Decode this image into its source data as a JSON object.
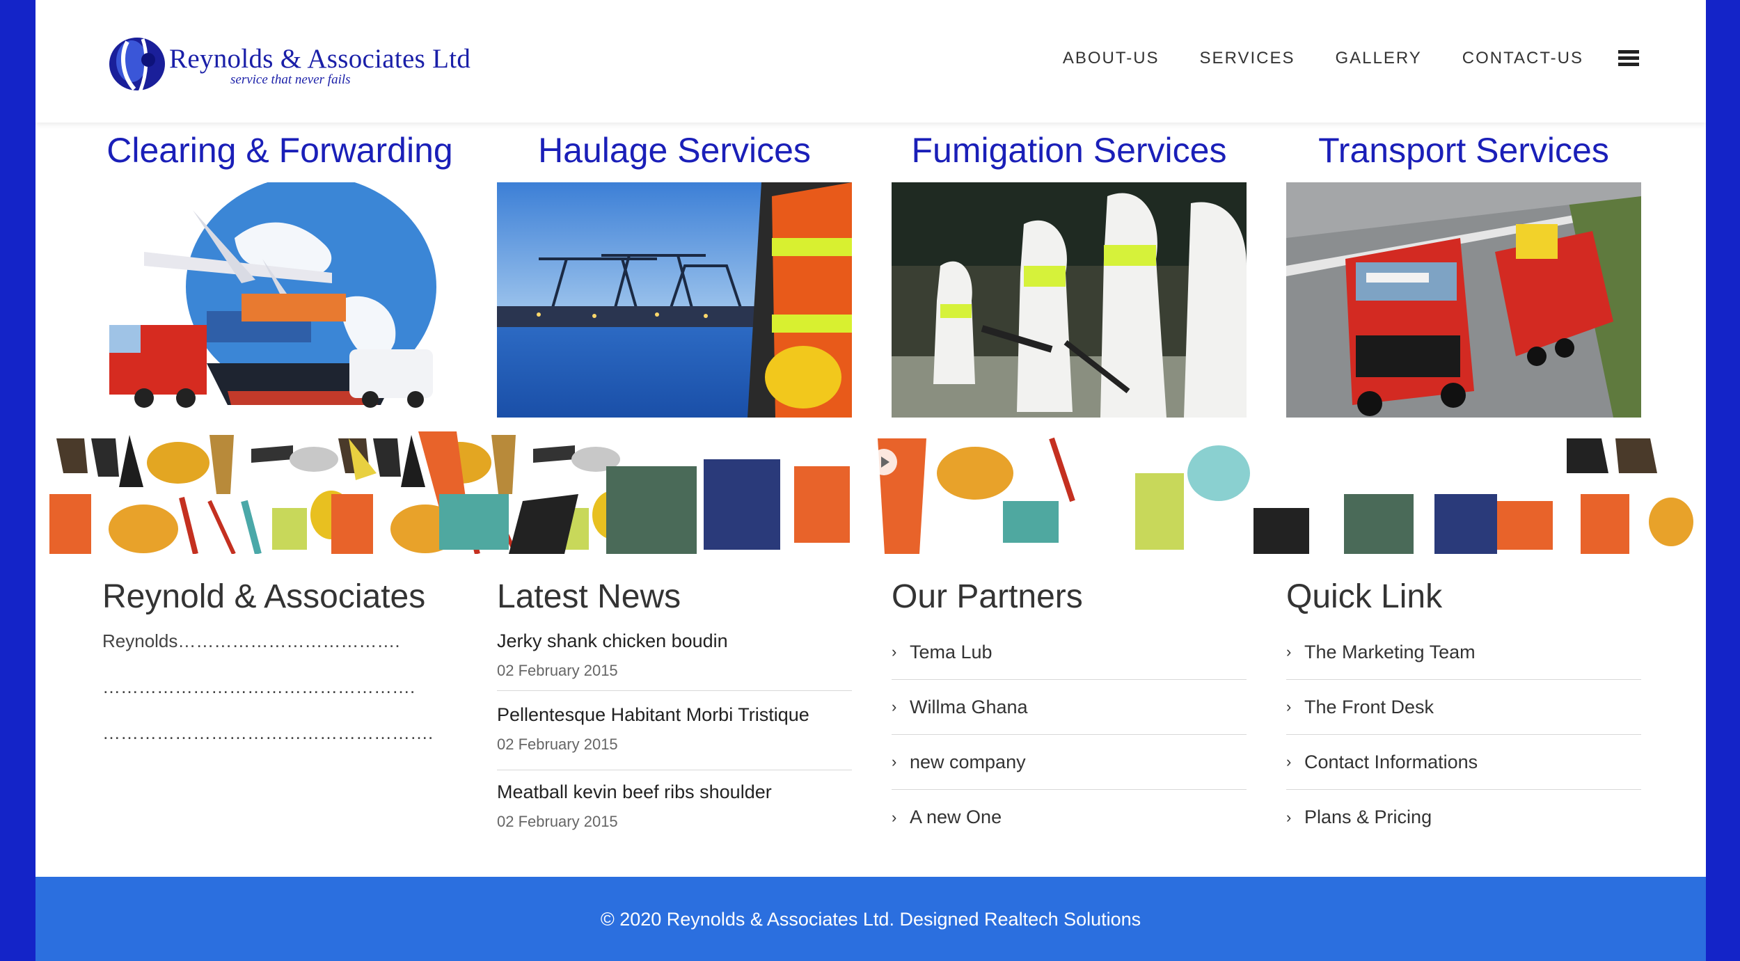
{
  "brand": {
    "name": "Reynolds & Associates Ltd",
    "tagline": "service that never fails",
    "accent": "#1a1fb8",
    "frame_color": "#1424c8",
    "footer_color": "#2b6fdf"
  },
  "nav": {
    "items": [
      "ABOUT-US",
      "SERVICES",
      "GALLERY",
      "CONTACT-US"
    ],
    "menu_icon": "hamburger-icon"
  },
  "services": [
    {
      "title": "Clearing & Forwarding",
      "image": "cargo-plane-globe-truck-ship"
    },
    {
      "title": "Haulage Services",
      "image": "port-cranes-worker-vest"
    },
    {
      "title": "Fumigation Services",
      "image": "workers-spraying-protective-suits"
    },
    {
      "title": "Transport Services",
      "image": "red-truck-trailer-highway"
    }
  ],
  "banner": {
    "image": "safety-equipment-collage",
    "control_icon": "play-icon"
  },
  "about": {
    "heading": "Reynold & Associates",
    "lines": [
      "Reynolds……………………………….",
      "…………………………………………….",
      "………………………………………………."
    ]
  },
  "news": {
    "heading": "Latest News",
    "items": [
      {
        "title": "Jerky shank chicken boudin",
        "date": "02 February 2015"
      },
      {
        "title": "Pellentesque Habitant Morbi Tristique",
        "date": "02 February 2015"
      },
      {
        "title": "Meatball kevin beef ribs shoulder",
        "date": "02 February 2015"
      }
    ]
  },
  "partners": {
    "heading": "Our Partners",
    "items": [
      "Tema Lub",
      "Willma Ghana",
      "new company",
      "A new One"
    ]
  },
  "quick_links": {
    "heading": "Quick Link",
    "items": [
      "The Marketing Team",
      "The Front Desk",
      "Contact Informations",
      "Plans & Pricing"
    ]
  },
  "footer": {
    "text": "© 2020 Reynolds & Associates Ltd. Designed Realtech Solutions"
  }
}
